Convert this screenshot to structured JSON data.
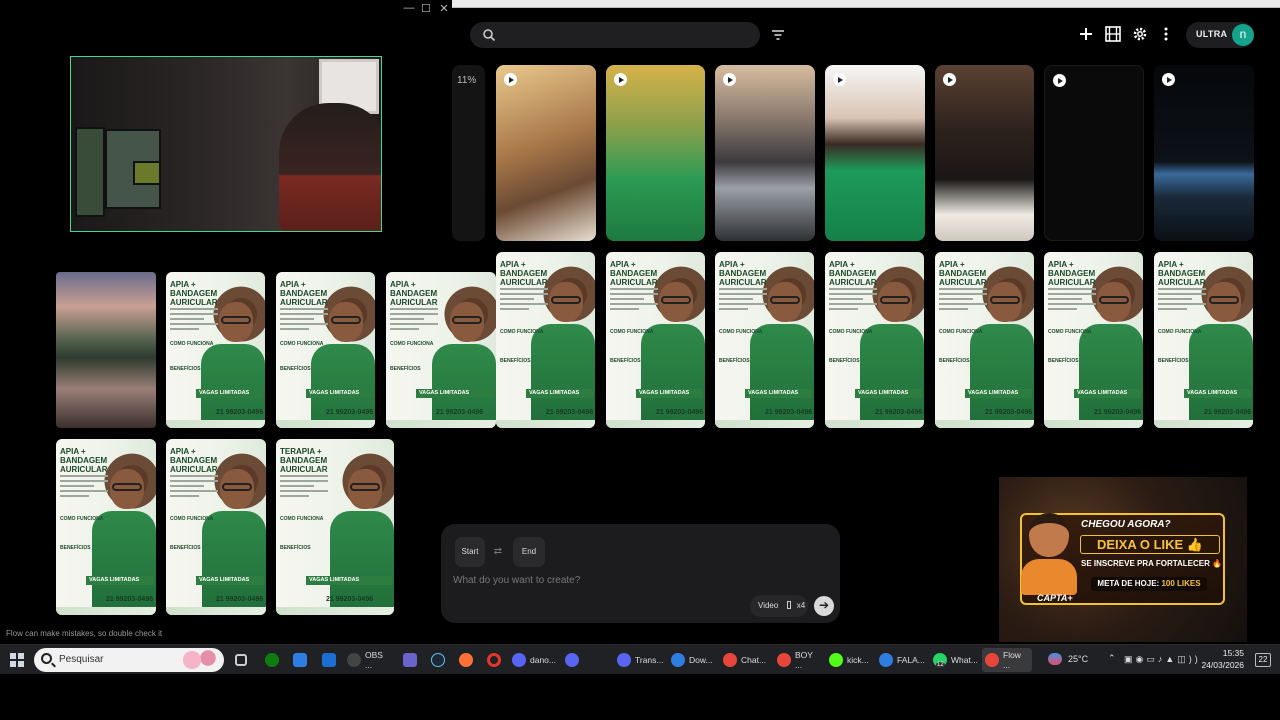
{
  "window_controls": {
    "minimize": "—",
    "maximize": "☐",
    "close": "✕"
  },
  "toolbar": {
    "search_placeholder": "",
    "plan_badge": "ULTRA",
    "avatar_letter": "n"
  },
  "gallery": {
    "progress_label": "11%"
  },
  "flyer": {
    "title_a": "APIA +",
    "title_b": "BANDAGEM",
    "title_c": "AURICULAR",
    "title_full_a": "TERAPIA +",
    "section_1": "COMO FUNCIONA",
    "section_2": "BENEFÍCIOS",
    "vagas": "VAGAS LIMITADAS",
    "phone": "21 99203-0496"
  },
  "composer": {
    "start_label": "Start",
    "swap_icon": "⇄",
    "end_label": "End",
    "placeholder": "What do you want to create?",
    "mode_label": "Video",
    "count_label": "x4",
    "go_icon": "➔"
  },
  "disclaimer": "Flow can make mistakes, so double check it",
  "banner": {
    "headline": "CHEGOU AGORA?",
    "cta": "DEIXA O LIKE",
    "subline": "SE INSCREVE PRA FORTALECER",
    "goal_prefix": "META DE HOJE:",
    "goal_value": "100 LIKES",
    "brand": "CAPTA+"
  },
  "taskbar": {
    "search_label": "Pesquisar",
    "apps": [
      {
        "label": "OBS ...",
        "color": "#444444"
      },
      {
        "label": "dano...",
        "color": "#5865f2"
      },
      {
        "label": "Trans...",
        "color": "#5865f2"
      },
      {
        "label": "Dow...",
        "color": "#2f7de1"
      },
      {
        "label": "Chat...",
        "color": "#e8453c"
      },
      {
        "label": "BOY ...",
        "color": "#e8453c"
      },
      {
        "label": "kick...",
        "color": "#53fc18"
      },
      {
        "label": "FALA...",
        "color": "#2f7de1"
      },
      {
        "label": "What...",
        "color": "#25d366"
      },
      {
        "label": "Flow ...",
        "color": "#e8453c"
      }
    ],
    "weather": "25°C",
    "time": "15:35",
    "date": "24/03/2026",
    "notifications": "22",
    "whatsapp_badge": "12"
  },
  "colors": {
    "accent": "#14a38b",
    "camera_border": "#4ed58a",
    "banner_gold": "#f2c230"
  }
}
